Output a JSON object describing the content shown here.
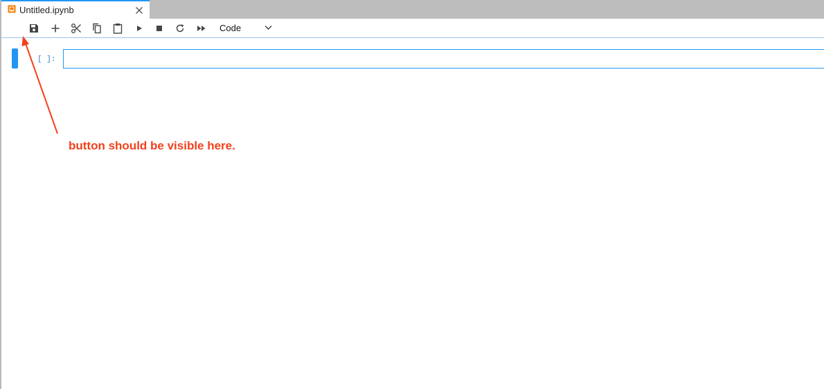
{
  "tab": {
    "title": "Untitled.ipynb",
    "icon": "notebook-icon",
    "close_icon": "close-icon",
    "accent_color": "#2196f3",
    "icon_color": "#f57c00"
  },
  "toolbar": {
    "buttons": [
      {
        "name": "save-button",
        "icon": "save-icon"
      },
      {
        "name": "insert-cell-button",
        "icon": "plus-icon"
      },
      {
        "name": "cut-button",
        "icon": "scissors-icon"
      },
      {
        "name": "copy-button",
        "icon": "copy-icon"
      },
      {
        "name": "paste-button",
        "icon": "clipboard-icon"
      },
      {
        "name": "run-button",
        "icon": "play-icon"
      },
      {
        "name": "interrupt-button",
        "icon": "stop-icon"
      },
      {
        "name": "restart-button",
        "icon": "refresh-icon"
      },
      {
        "name": "run-all-button",
        "icon": "fast-forward-icon"
      }
    ],
    "cell_type": "Code",
    "cell_type_icon": "chevron-down-icon"
  },
  "cell": {
    "prompt": "[ ]:",
    "value": "",
    "active_color": "#2196f3",
    "prompt_color": "#307fc1"
  },
  "annotation": {
    "text": "button should be visible here.",
    "color": "#f3401c"
  }
}
